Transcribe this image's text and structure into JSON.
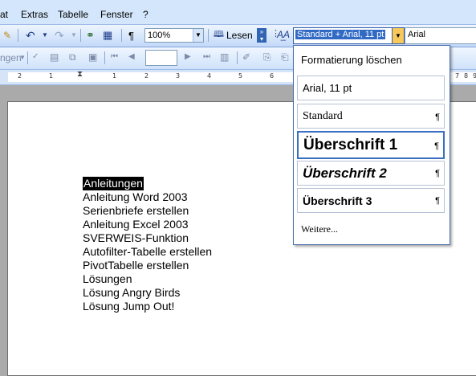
{
  "menu": {
    "items": [
      "at",
      "Extras",
      "Tabelle",
      "Fenster",
      "?"
    ]
  },
  "toolbar1": {
    "zoom_value": "100%",
    "read_label": "Lesen",
    "paragraph_mark": "¶",
    "style_value": "Standard + Arial, 11 pt",
    "font_value": "Arial"
  },
  "toolbar2": {
    "left_fragment": "ngen",
    "page_field_value": ""
  },
  "ruler": {
    "ticks": [
      "2",
      "1",
      "1",
      "2",
      "3",
      "4",
      "5",
      "6",
      "7",
      "8",
      "9"
    ]
  },
  "document": {
    "lines": [
      "Anleitungen",
      "Anleitung Word 2003",
      "Serienbriefe erstellen",
      "Anleitung Excel 2003",
      "SVERWEIS-Funktion",
      "Autofilter-Tabelle erstellen",
      "PivotTabelle erstellen",
      "Lösungen",
      "Lösung Angry Birds",
      "Lösung Jump Out!"
    ]
  },
  "style_dropdown": {
    "clear_label": "Formatierung löschen",
    "items": [
      {
        "label": "Arial, 11 pt"
      },
      {
        "label": "Standard",
        "mark": "¶"
      },
      {
        "label": "Überschrift 1",
        "mark": "¶"
      },
      {
        "label": "Überschrift 2",
        "mark": "¶"
      },
      {
        "label": "Überschrift 3",
        "mark": "¶"
      }
    ],
    "more_label": "Weitere..."
  }
}
